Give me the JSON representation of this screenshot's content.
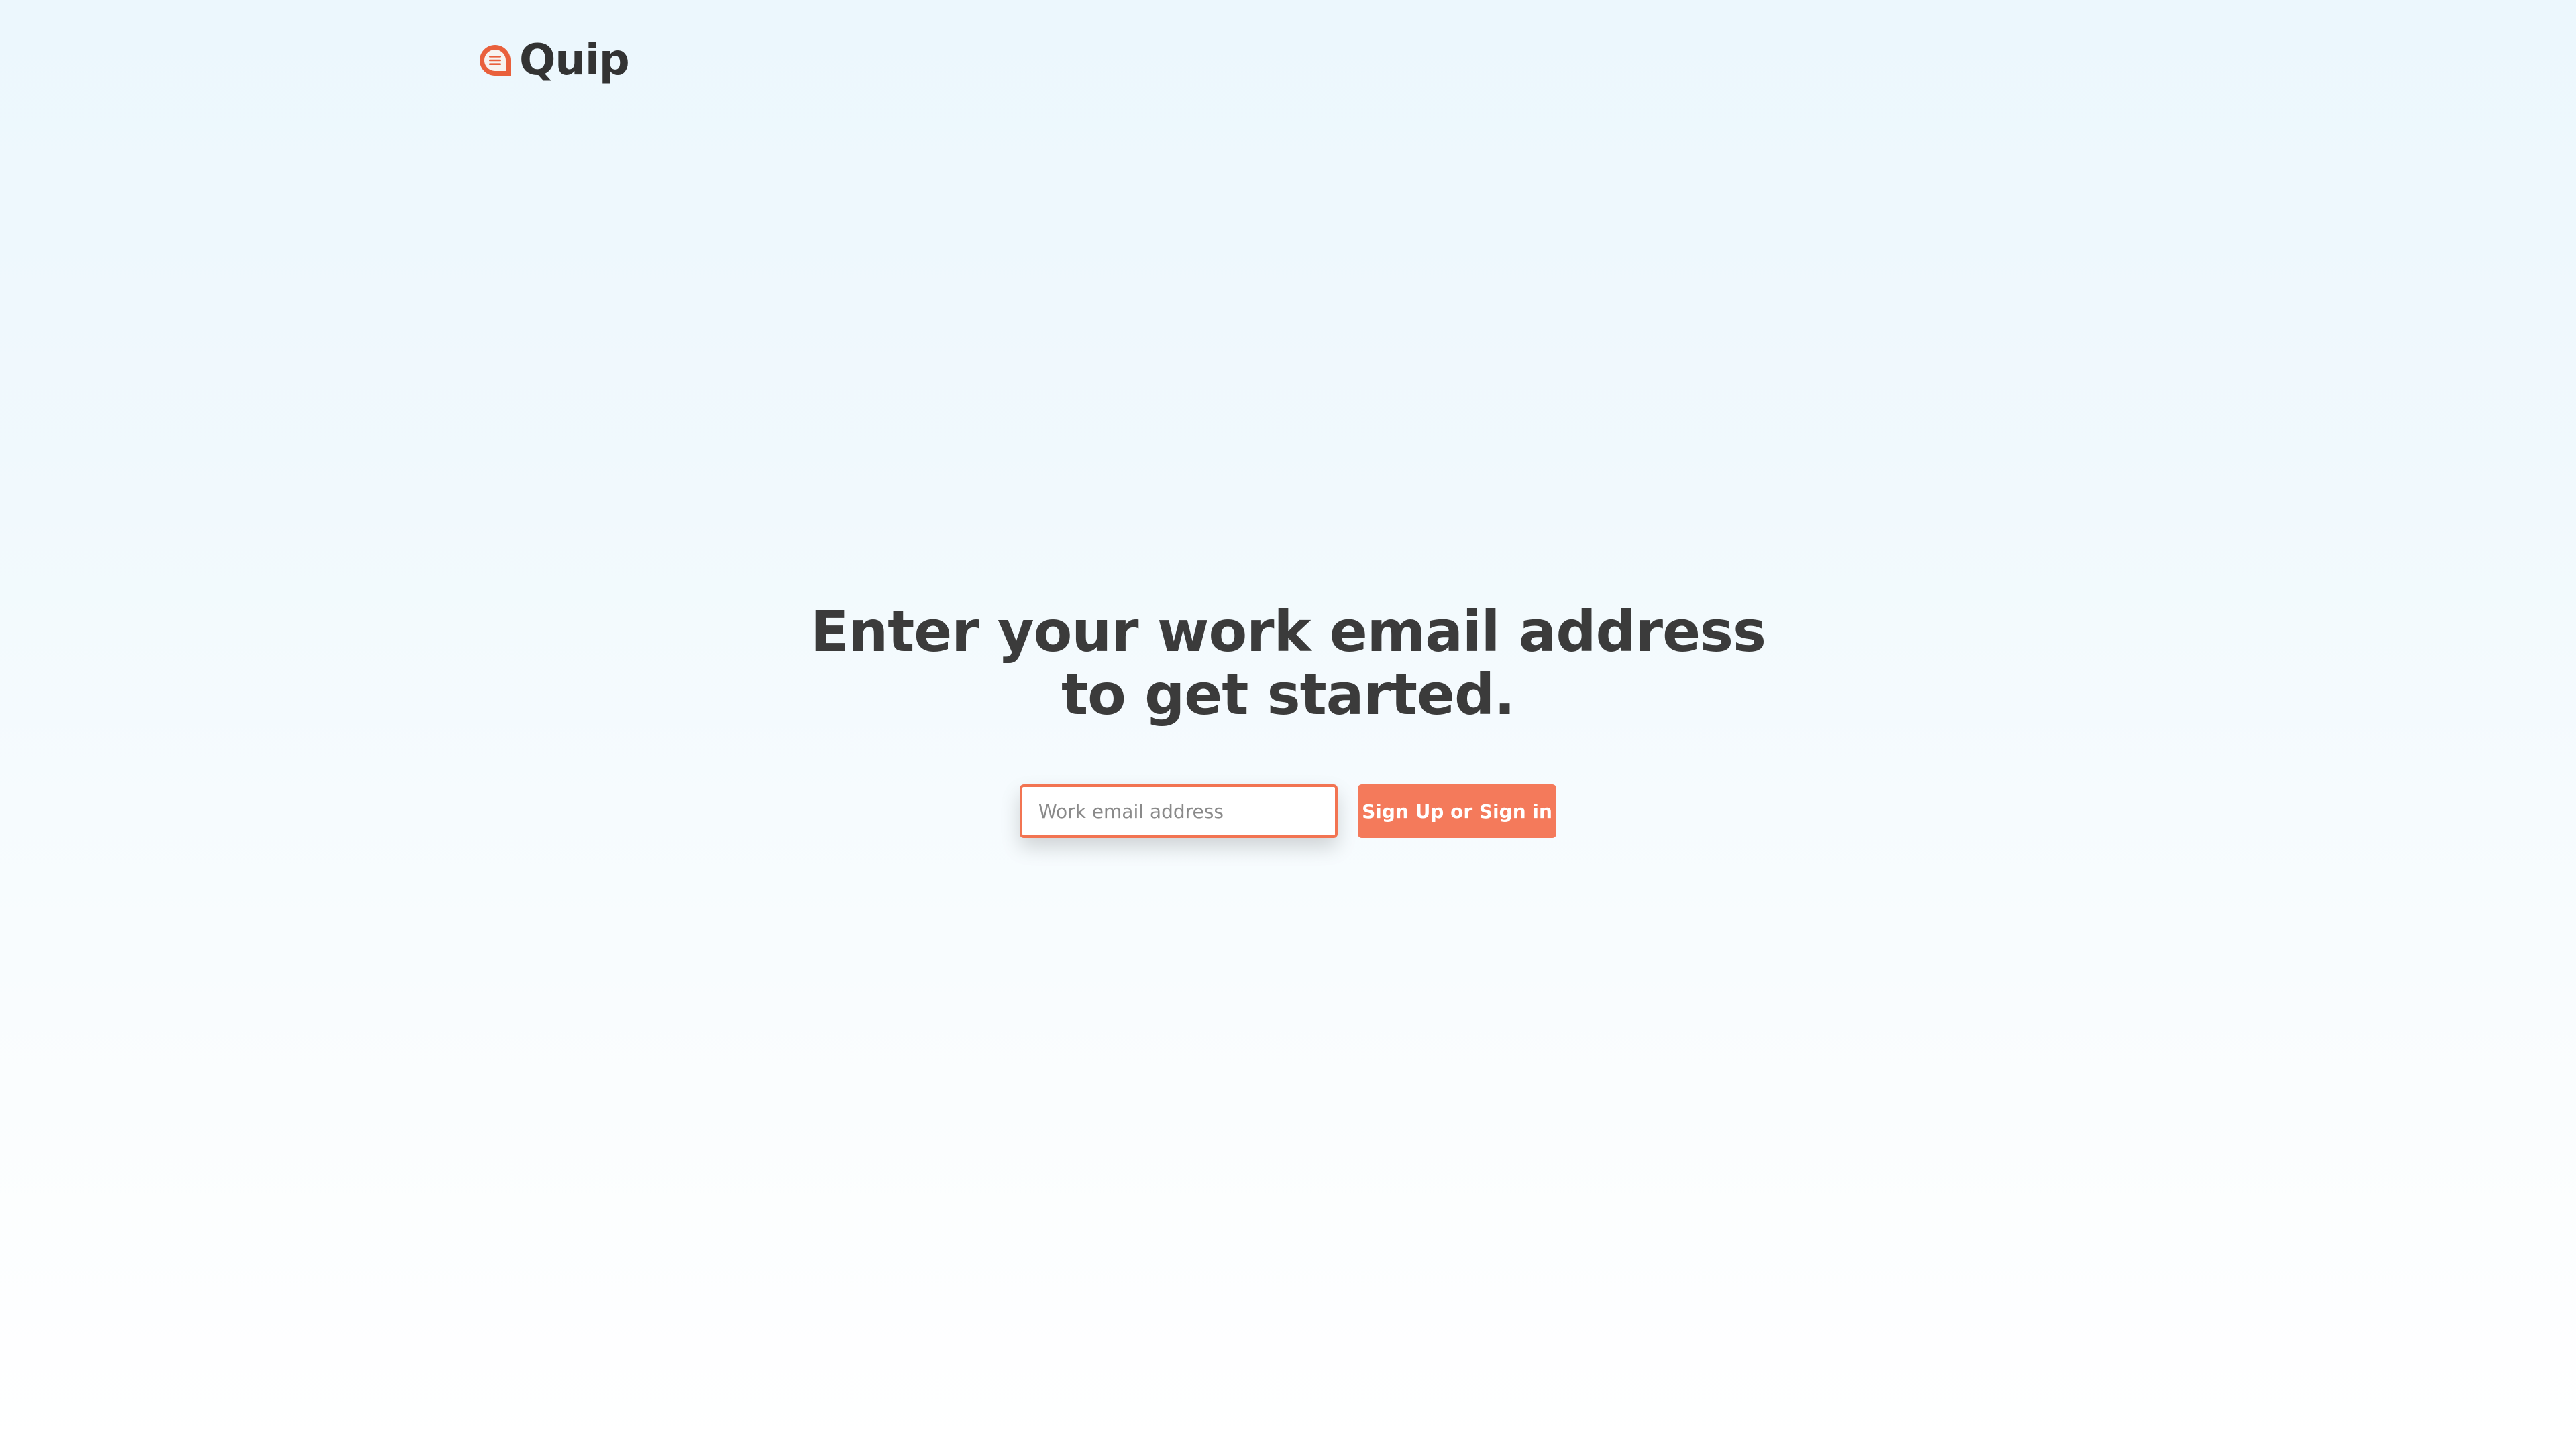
{
  "brand": {
    "name": "Quip",
    "accent_color": "#f47a5b",
    "icon": "quip-logo-icon"
  },
  "hero": {
    "title_line_1": "Enter your work email address",
    "title_line_2": "to get started."
  },
  "signup": {
    "email_placeholder": "Work email address",
    "email_value": "",
    "button_label": "Sign Up or Sign in"
  }
}
